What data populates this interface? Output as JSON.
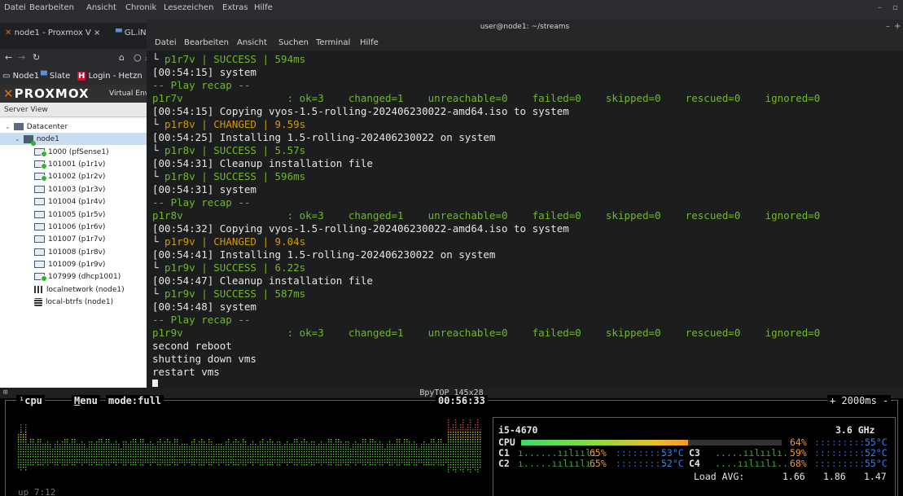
{
  "browser_menu": [
    "Datei",
    "Bearbeiten",
    "Ansicht",
    "Chronik",
    "Lesezeichen",
    "Extras",
    "Hilfe"
  ],
  "browser_tabs": [
    {
      "label": "node1 - Proxmox V ×"
    },
    {
      "label": "GL.iNe"
    }
  ],
  "bookmarks": [
    "Node1",
    "Slate",
    "Login - Hetzn"
  ],
  "pve": {
    "logo": "PROXMOX",
    "subtitle": "Virtual Envir",
    "server_view": "Server View",
    "tree": [
      {
        "label": "Datacenter",
        "type": "datacenter"
      },
      {
        "label": "node1",
        "type": "node"
      },
      {
        "label": "1000 (pfSense1)",
        "type": "vm-running"
      },
      {
        "label": "101001 (p1r1v)",
        "type": "vm-running"
      },
      {
        "label": "101002 (p1r2v)",
        "type": "vm-running"
      },
      {
        "label": "101003 (p1r3v)",
        "type": "vm"
      },
      {
        "label": "101004 (p1r4v)",
        "type": "vm"
      },
      {
        "label": "101005 (p1r5v)",
        "type": "vm"
      },
      {
        "label": "101006 (p1r6v)",
        "type": "vm"
      },
      {
        "label": "101007 (p1r7v)",
        "type": "vm"
      },
      {
        "label": "101008 (p1r8v)",
        "type": "vm"
      },
      {
        "label": "101009 (p1r9v)",
        "type": "vm"
      },
      {
        "label": "107999 (dhcp1001)",
        "type": "vm-running"
      },
      {
        "label": "localnetwork (node1)",
        "type": "network"
      },
      {
        "label": "local-btrfs (node1)",
        "type": "storage"
      }
    ]
  },
  "terminal": {
    "title": "user@node1: ~/streams",
    "menu": [
      "Datei",
      "Bearbeiten",
      "Ansicht",
      "Suchen",
      "Terminal",
      "Hilfe"
    ],
    "lines": [
      [
        {
          "c": "g",
          "t": "  p1r7v | SUCCESS | 594ms"
        }
      ],
      [
        {
          "c": "w",
          "t": "[00:54:15] system"
        }
      ],
      [
        {
          "c": "g",
          "t": "-- Play recap --"
        }
      ],
      [
        {
          "c": "g",
          "t": "p1r7v                 : ok=3    changed=1    unreachable=0    failed=0    skipped=0    rescued=0    ignored=0"
        }
      ],
      [
        {
          "c": "w",
          "t": "[00:54:15] Copying vyos-1.5-rolling-202406230022-amd64.iso to system"
        }
      ],
      [
        {
          "c": "o",
          "t": "  p1r8v | CHANGED | 9.59s"
        }
      ],
      [
        {
          "c": "w",
          "t": "[00:54:25] Installing 1.5-rolling-202406230022 on system"
        }
      ],
      [
        {
          "c": "g",
          "t": "  p1r8v | SUCCESS | 5.57s"
        }
      ],
      [
        {
          "c": "w",
          "t": "[00:54:31] Cleanup installation file"
        }
      ],
      [
        {
          "c": "g",
          "t": "  p1r8v | SUCCESS | 596ms"
        }
      ],
      [
        {
          "c": "w",
          "t": "[00:54:31] system"
        }
      ],
      [
        {
          "c": "g",
          "t": "-- Play recap --"
        }
      ],
      [
        {
          "c": "g",
          "t": "p1r8v                 : ok=3    changed=1    unreachable=0    failed=0    skipped=0    rescued=0    ignored=0"
        }
      ],
      [
        {
          "c": "w",
          "t": "[00:54:32] Copying vyos-1.5-rolling-202406230022-amd64.iso to system"
        }
      ],
      [
        {
          "c": "o",
          "t": "  p1r9v | CHANGED | 9.04s"
        }
      ],
      [
        {
          "c": "w",
          "t": "[00:54:41] Installing 1.5-rolling-202406230022 on system"
        }
      ],
      [
        {
          "c": "g",
          "t": "  p1r9v | SUCCESS | 6.22s"
        }
      ],
      [
        {
          "c": "w",
          "t": "[00:54:47] Cleanup installation file"
        }
      ],
      [
        {
          "c": "g",
          "t": "  p1r9v | SUCCESS | 587ms"
        }
      ],
      [
        {
          "c": "w",
          "t": "[00:54:48] system"
        }
      ],
      [
        {
          "c": "g",
          "t": "-- Play recap --"
        }
      ],
      [
        {
          "c": "g",
          "t": "p1r9v                 : ok=3    changed=1    unreachable=0    failed=0    skipped=0    rescued=0    ignored=0"
        }
      ],
      [
        {
          "c": "w",
          "t": "second reboot"
        }
      ],
      [
        {
          "c": "w",
          "t": "shutting down vms"
        }
      ],
      [
        {
          "c": "w",
          "t": "restart vms"
        }
      ]
    ]
  },
  "btop": {
    "window_title": "BpyTOP 145x28",
    "tab_cpu": "cpu",
    "tab_cpu_num": "¹",
    "menu": "Menu",
    "mode": "mode:full",
    "clock": "00:56:33",
    "interval": "+ 2000ms -",
    "uptime": "up 7:12",
    "cpu_model": "i5-4670",
    "freq": "3.6 GHz",
    "cpu_total": {
      "label": "CPU",
      "pct": "64%",
      "pct_value": 64,
      "temp": "55°C"
    },
    "cores": [
      {
        "label": "C1",
        "pct": "65%",
        "temp": "53°C"
      },
      {
        "label": "C2",
        "pct": "65%",
        "temp": "52°C"
      },
      {
        "label": "C3",
        "pct": "59%",
        "temp": "52°C"
      },
      {
        "label": "C4",
        "pct": "68%",
        "temp": "55°C"
      }
    ],
    "load_label": "Load AVG:",
    "load": [
      "1.66",
      "1.86",
      "1.47"
    ]
  },
  "colors": {
    "ansible_green": "#76b52a",
    "ansible_orange": "#d19a00",
    "proxmox_orange": "#e57000"
  }
}
